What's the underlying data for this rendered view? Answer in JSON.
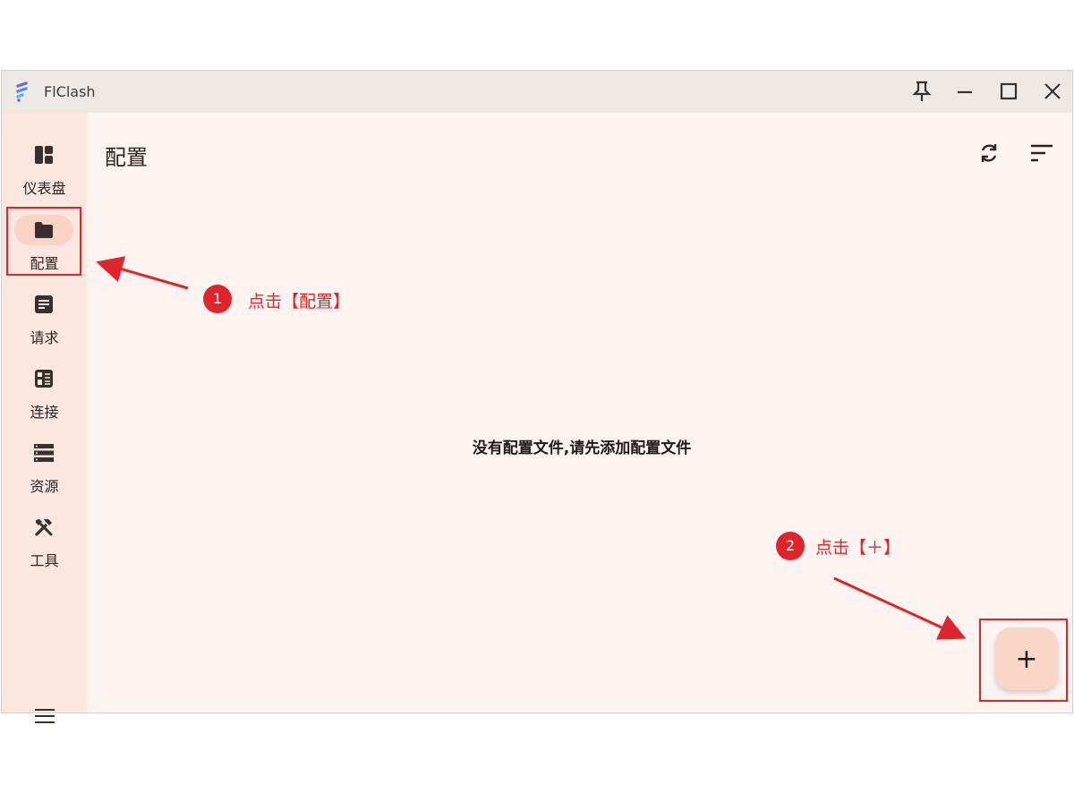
{
  "window": {
    "title": "FlClash"
  },
  "sidebar": {
    "items": [
      {
        "label": "仪表盘",
        "icon": "dashboard-icon",
        "active": false
      },
      {
        "label": "配置",
        "icon": "folder-icon",
        "active": true
      },
      {
        "label": "请求",
        "icon": "request-icon",
        "active": false
      },
      {
        "label": "连接",
        "icon": "connection-icon",
        "active": false
      },
      {
        "label": "资源",
        "icon": "resource-icon",
        "active": false
      },
      {
        "label": "工具",
        "icon": "tools-icon",
        "active": false
      }
    ]
  },
  "main": {
    "title": "配置",
    "empty_message": "没有配置文件,请先添加配置文件",
    "fab_label": "+"
  },
  "annotations": {
    "step1": {
      "number": "1",
      "text": "点击【配置】"
    },
    "step2": {
      "number": "2",
      "text": "点击【＋】"
    },
    "color": "#e0242b"
  },
  "colors": {
    "background": "#fdf4f1",
    "sidebar": "#fbe6e0",
    "accent": "#f9d6c8",
    "titlebar": "#efe9e6"
  }
}
